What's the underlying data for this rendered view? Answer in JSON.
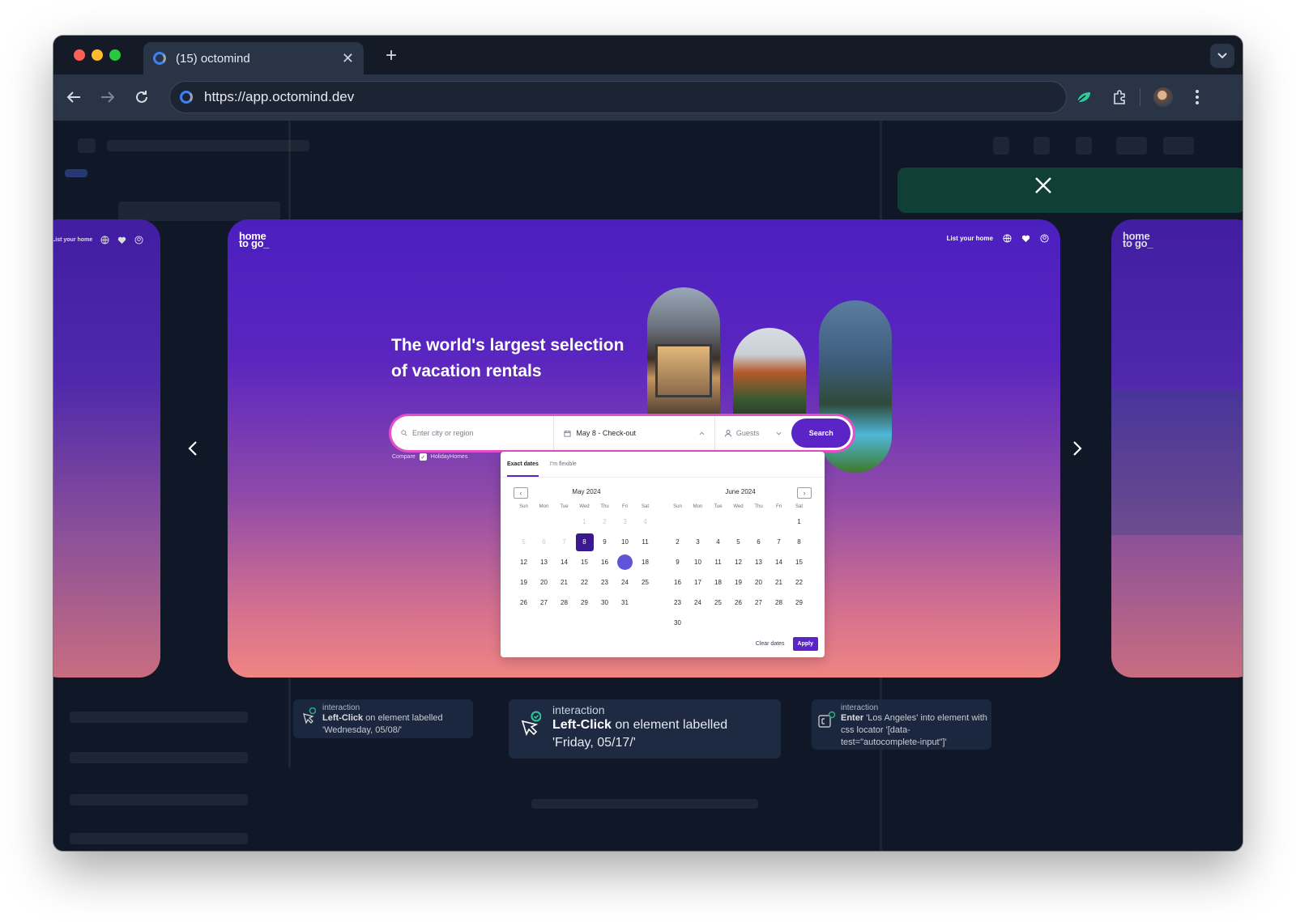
{
  "browser": {
    "tab_title": "(15) octomind",
    "new_tab": "+",
    "url": "https://app.octomind.dev",
    "colors": {
      "close": "#ff5f57",
      "minimize": "#febc2e",
      "maximize": "#28c840"
    }
  },
  "hometogo": {
    "logo_line1": "home",
    "logo_line2": "to go_",
    "list_home": "List your home",
    "headline": "The world's largest selection of vacation rentals",
    "search": {
      "destination_placeholder": "Enter city or region",
      "dates_value": "May 8 - Check-out",
      "guests_placeholder": "Guests",
      "search_label": "Search"
    },
    "compare_label": "Compare",
    "compare_option": "HolidayHomes",
    "calendar": {
      "tab_exact": "Exact dates",
      "tab_flexible": "I'm flexible",
      "weekdays": [
        "Sun",
        "Mon",
        "Tue",
        "Wed",
        "Thu",
        "Fri",
        "Sat"
      ],
      "months": [
        {
          "title": "May 2024",
          "offset": 3,
          "days": 31,
          "disabled_until": 7,
          "selected": 8,
          "hover": 17
        },
        {
          "title": "June 2024",
          "offset": 6,
          "days": 30,
          "disabled_until": 0,
          "selected": null,
          "hover": null
        }
      ],
      "clear_label": "Clear dates",
      "apply_label": "Apply"
    },
    "colors": {
      "brand": "#5a24c7",
      "selected_day": "#3a1890",
      "hover_day": "#6055d9"
    }
  },
  "interactions": [
    {
      "header": "interaction",
      "action": "Left-Click",
      "rest": "on element labelled 'Wednesday, 05/08/'"
    },
    {
      "header": "interaction",
      "action": "Left-Click",
      "rest": "on element labelled 'Friday, 05/17/'"
    },
    {
      "header": "interaction",
      "action": "Enter",
      "rest": "'Los Angeles' into element with css locator '[data-test=\"autocomplete-input\"]'"
    }
  ]
}
